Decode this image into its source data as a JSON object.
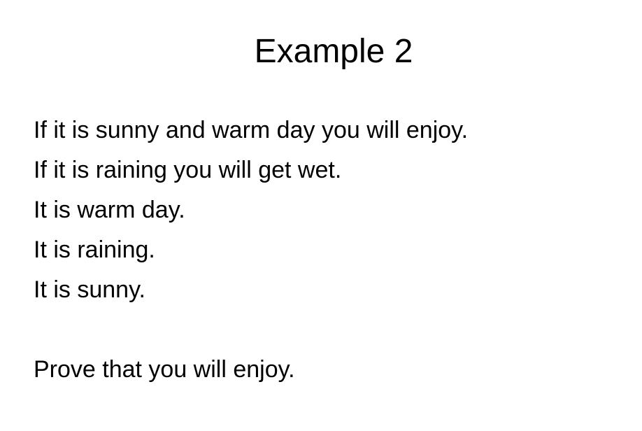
{
  "slide": {
    "title": "Example 2",
    "premises": [
      "If it is sunny and warm day you will enjoy.",
      "If it is raining you will get wet.",
      "It is warm day.",
      "It is raining.",
      "It is sunny."
    ],
    "goal": "Prove that you will enjoy."
  }
}
